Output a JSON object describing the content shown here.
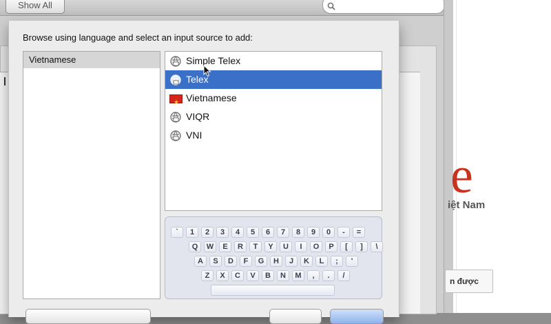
{
  "toolbar": {
    "show_all_label": "Show All",
    "search_placeholder": ""
  },
  "dialog": {
    "prompt": "Browse using language and select an input source to add:",
    "languages": [
      {
        "label": "Vietnamese",
        "selected": true
      }
    ],
    "input_sources": [
      {
        "label": "Simple Telex",
        "icon": "input-source-icon",
        "selected": false
      },
      {
        "label": "Telex",
        "icon": "input-source-icon",
        "selected": true
      },
      {
        "label": "Vietnamese",
        "icon": "vietnam-flag-icon",
        "selected": false
      },
      {
        "label": "VIQR",
        "icon": "input-source-icon",
        "selected": false
      },
      {
        "label": "VNI",
        "icon": "input-source-icon",
        "selected": false
      }
    ],
    "keyboard_rows": [
      [
        "`",
        "1",
        "2",
        "3",
        "4",
        "5",
        "6",
        "7",
        "8",
        "9",
        "0",
        "-",
        "="
      ],
      [
        "Q",
        "W",
        "E",
        "R",
        "T",
        "Y",
        "U",
        "I",
        "O",
        "P",
        "[",
        "]",
        "\\"
      ],
      [
        "A",
        "S",
        "D",
        "F",
        "G",
        "H",
        "J",
        "K",
        "L",
        ";",
        "'"
      ],
      [
        "Z",
        "X",
        "C",
        "V",
        "B",
        "N",
        "M",
        ",",
        ".",
        "/"
      ]
    ]
  },
  "webpage": {
    "brand_letter": "e",
    "brand_text": "iệt Nam",
    "button_label": "n được"
  },
  "colors": {
    "selection": "#3a70c8",
    "brand_red": "#c8321f"
  }
}
